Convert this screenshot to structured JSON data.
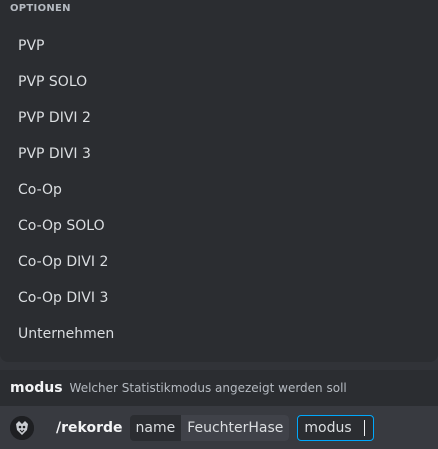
{
  "options": {
    "header": "OPTIONEN",
    "items": [
      "PVP",
      "PVP SOLO",
      "PVP DIVI 2",
      "PVP DIVI 3",
      "Co-Op",
      "Co-Op SOLO",
      "Co-Op DIVI 2",
      "Co-Op DIVI 3",
      "Unternehmen"
    ]
  },
  "hint": {
    "param_name": "modus",
    "description": "Welcher Statistikmodus angezeigt werden soll"
  },
  "command": {
    "icon": "bot-avatar-icon",
    "name": "/rekorde",
    "params": [
      {
        "label": "name",
        "value": "FeuchterHase"
      },
      {
        "label": "modus",
        "value": ""
      }
    ]
  },
  "colors": {
    "background": "#313338",
    "panel": "#2b2d31",
    "input": "#383a40",
    "focus_border": "#00a8fc"
  }
}
